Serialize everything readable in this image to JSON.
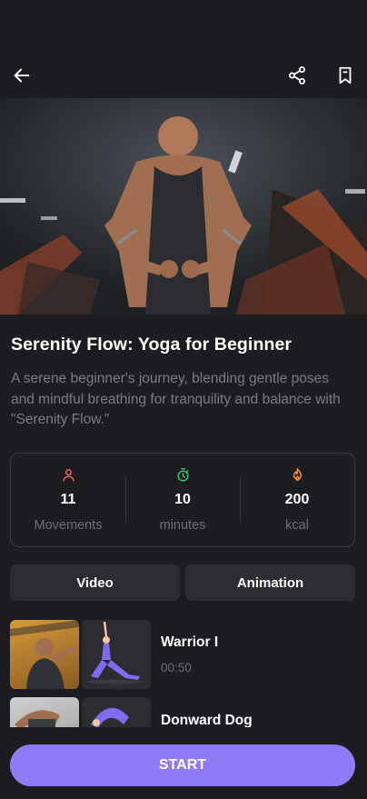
{
  "header": {
    "back_icon": "arrow-left-icon",
    "share_icon": "share-icon",
    "bookmark_icon": "bookmark-icon"
  },
  "workout": {
    "title": "Serenity Flow: Yoga for Beginner",
    "description": "A serene beginner's journey, blending gentle poses and mindful breathing for tranquility and balance with \"Serenity Flow.\""
  },
  "stats": [
    {
      "icon": "person-icon",
      "color": "#e5654f",
      "value": "11",
      "label": "Movements"
    },
    {
      "icon": "timer-icon",
      "color": "#3fbf6a",
      "value": "10",
      "label": "minutes"
    },
    {
      "icon": "flame-icon",
      "color": "#f08a3c",
      "value": "200",
      "label": "kcal"
    }
  ],
  "tabs": {
    "video": "Video",
    "animation": "Animation"
  },
  "exercises": [
    {
      "name": "Warrior I",
      "duration": "00:50"
    },
    {
      "name": "Donward Dog",
      "duration": ""
    }
  ],
  "start_label": "START",
  "colors": {
    "accent": "#8d7cf4",
    "background": "#1c1c21",
    "card": "#2c2c31"
  }
}
